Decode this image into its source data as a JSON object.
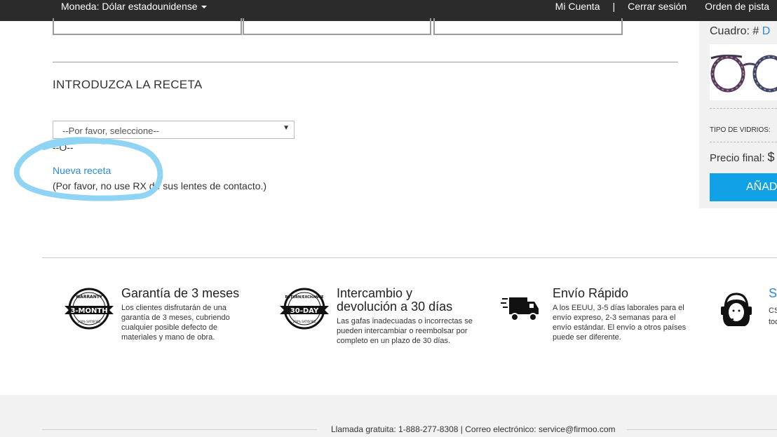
{
  "topbar": {
    "currency_label": "Moneda: Dólar estadounidense",
    "my_account": "Mi Cuenta",
    "separator": "|",
    "logout": "Cerrar sesión",
    "track_order": "Orden de pista"
  },
  "prescription": {
    "title": "INTRODUZCA LA RECETA",
    "select_value": "--Por favor, seleccione--",
    "or_text": "--O--",
    "new_link": "Nueva receta",
    "note": "(Por favor, no use RX de sus lentes de contacto.)"
  },
  "sidebar": {
    "frame_label": "Cuadro: #",
    "frame_number": "D",
    "lens_type": "TIPO DE VIDRIOS: ",
    "final_price_label": "Precio final: ",
    "currency_symbol": "$",
    "add_button": "AÑAD"
  },
  "features": [
    {
      "badge_line1": "WARRANTY",
      "badge_line2": "3-MONTH",
      "badge_line3": "100% SATISFIED",
      "title": "Garantía de 3 meses",
      "desc": "Los clientes disfrutarán de una garantía de 3 meses, cubriendo cualquier posible defecto de materiales y mano de obra."
    },
    {
      "badge_line1": "RETURN/EXCHANGE",
      "badge_line2": "30-DAY",
      "badge_line3": "100% SATISFIED",
      "title": "Intercambio y devolución a 30 días",
      "desc": "Las gafas inadecuadas o incorrectas se pueden intercambiar o reembolsar por completo en un plazo de 30 días."
    },
    {
      "title": "Envío Rápido",
      "desc": "A los EEUU, 3-5 días laborales para el envío expreso, 2-3 semanas para el envío estándar. El envío a otros países puede ser diferente."
    },
    {
      "title": "Se",
      "desc_line1": "CS",
      "desc_line2": "tod"
    }
  ],
  "footer": {
    "contact": "Llamada gratuita: 1-888-277-8308 | Correo electrónico: service@firmoo.com"
  },
  "colors": {
    "topbar_bg": "#2b2b2b",
    "link": "#2a8ccf",
    "highlight": "#8fd3f5",
    "add_button": "#10a0e6"
  }
}
